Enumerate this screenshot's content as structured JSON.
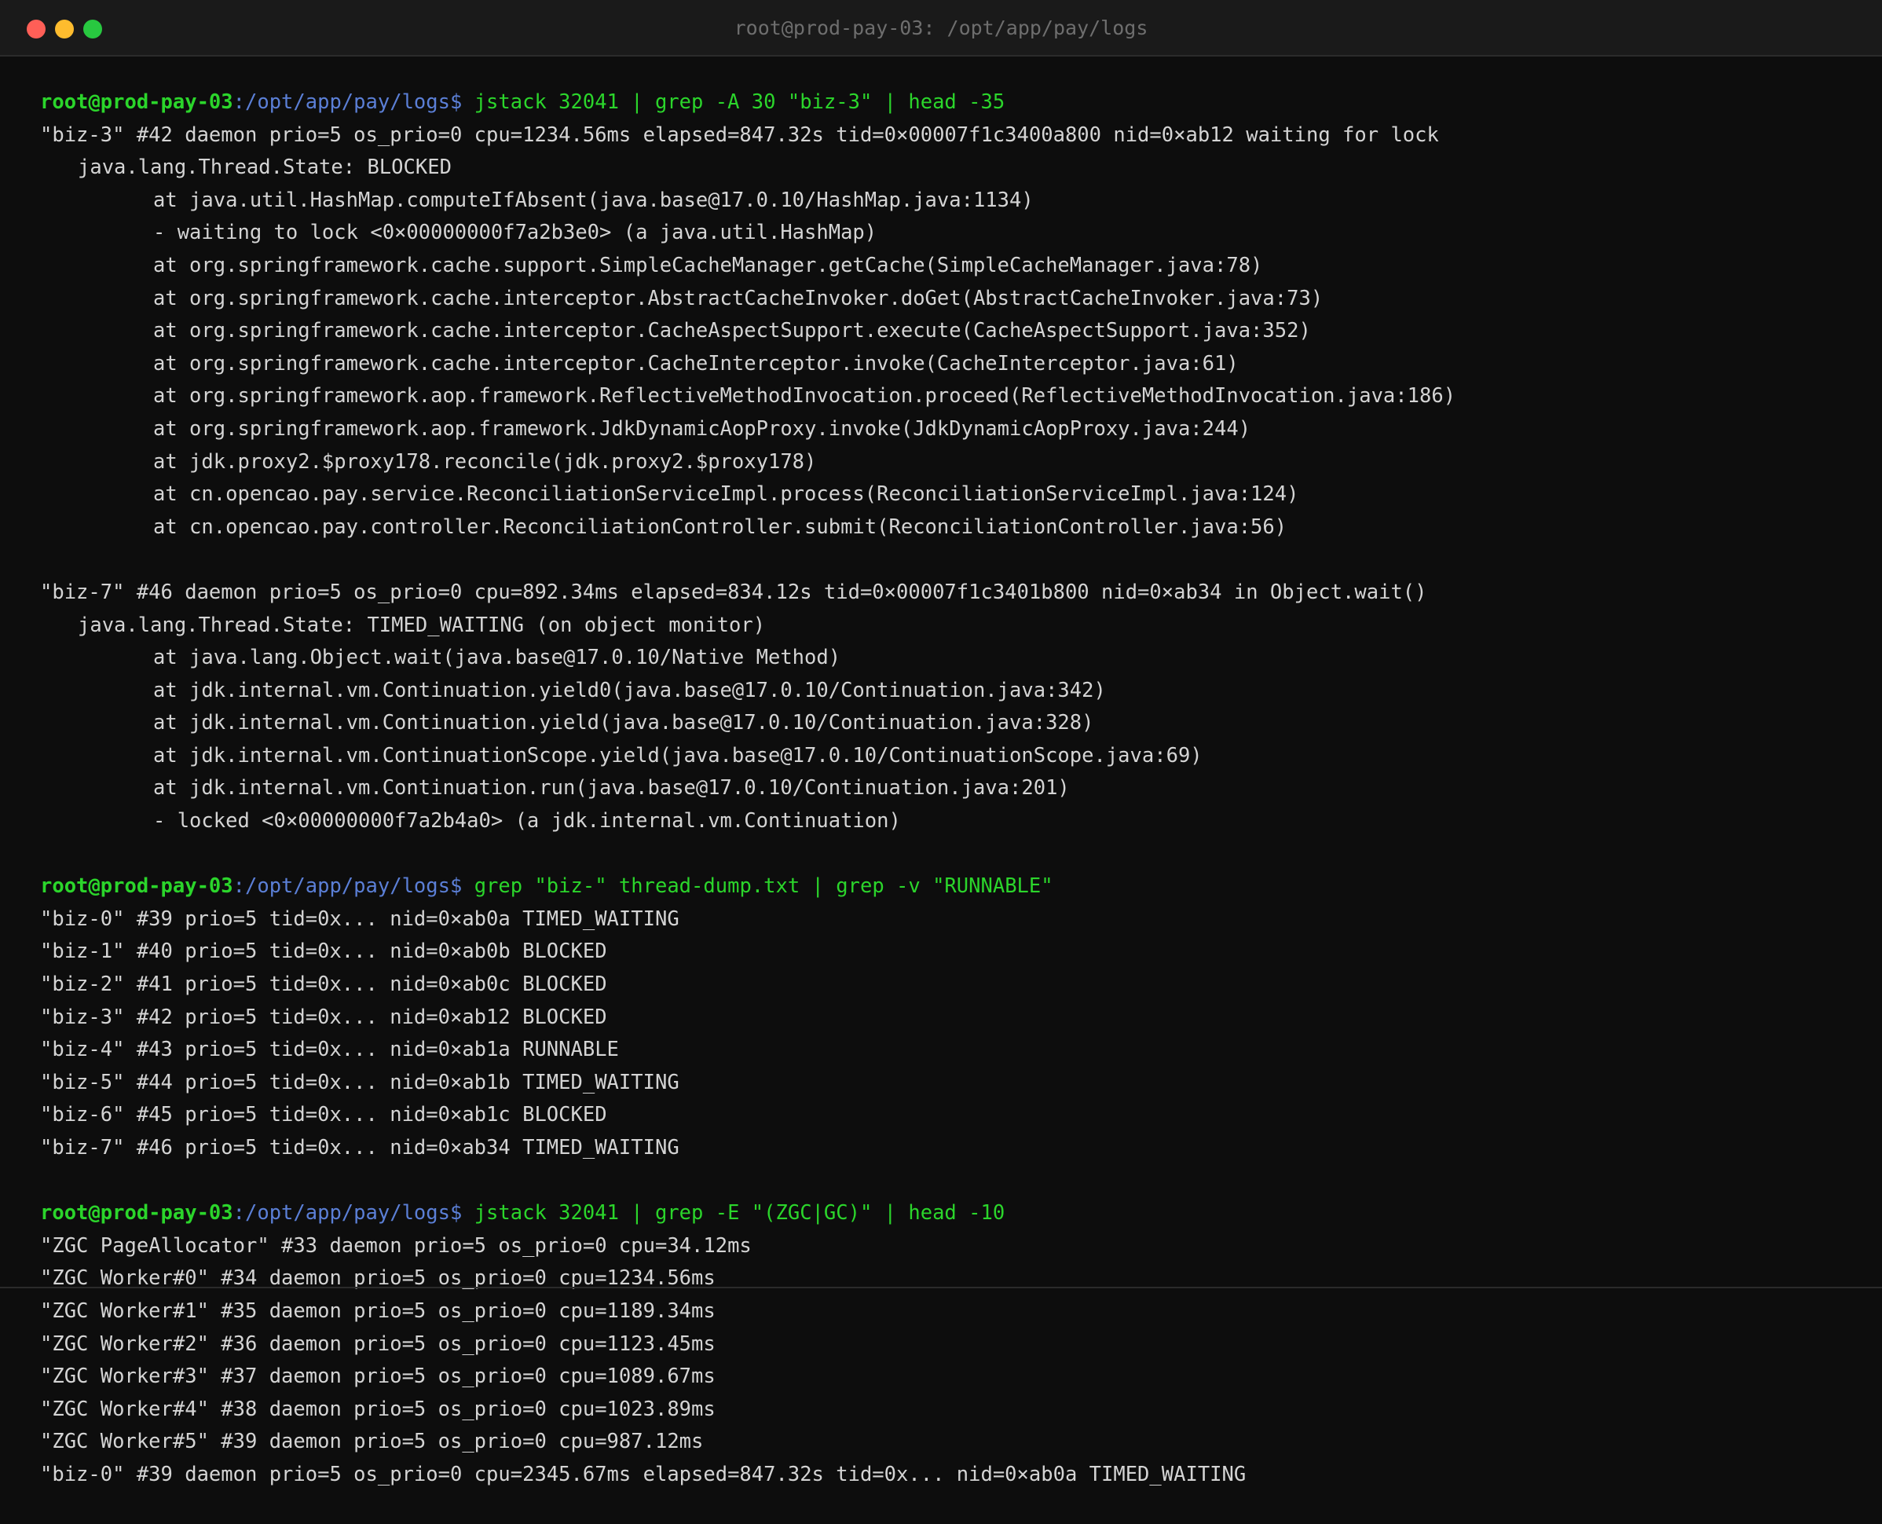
{
  "window": {
    "title": "root@prod-pay-03: /opt/app/pay/logs"
  },
  "prompt": {
    "user_host": "root@prod-pay-03",
    "path": ":/opt/app/pay/logs",
    "symbol": "$"
  },
  "blocks": [
    {
      "command": " jstack 32041 | grep -A 30 \"biz-3\" | head -35",
      "output": [
        {
          "indent": 0,
          "text": "\"biz-3\" #42 daemon prio=5 os_prio=0 cpu=1234.56ms elapsed=847.32s tid=0×00007f1c3400a800 nid=0×ab12 waiting for lock"
        },
        {
          "indent": 1,
          "text": "java.lang.Thread.State: BLOCKED"
        },
        {
          "indent": 2,
          "text": "at java.util.HashMap.computeIfAbsent(java.base@17.0.10/HashMap.java:1134)"
        },
        {
          "indent": 2,
          "text": "- waiting to lock <0×00000000f7a2b3e0> (a java.util.HashMap)"
        },
        {
          "indent": 2,
          "text": "at org.springframework.cache.support.SimpleCacheManager.getCache(SimpleCacheManager.java:78)"
        },
        {
          "indent": 2,
          "text": "at org.springframework.cache.interceptor.AbstractCacheInvoker.doGet(AbstractCacheInvoker.java:73)"
        },
        {
          "indent": 2,
          "text": "at org.springframework.cache.interceptor.CacheAspectSupport.execute(CacheAspectSupport.java:352)"
        },
        {
          "indent": 2,
          "text": "at org.springframework.cache.interceptor.CacheInterceptor.invoke(CacheInterceptor.java:61)"
        },
        {
          "indent": 2,
          "text": "at org.springframework.aop.framework.ReflectiveMethodInvocation.proceed(ReflectiveMethodInvocation.java:186)"
        },
        {
          "indent": 2,
          "text": "at org.springframework.aop.framework.JdkDynamicAopProxy.invoke(JdkDynamicAopProxy.java:244)"
        },
        {
          "indent": 2,
          "text": "at jdk.proxy2.$proxy178.reconcile(jdk.proxy2.$proxy178)"
        },
        {
          "indent": 2,
          "text": "at cn.opencao.pay.service.ReconciliationServiceImpl.process(ReconciliationServiceImpl.java:124)"
        },
        {
          "indent": 2,
          "text": "at cn.opencao.pay.controller.ReconciliationController.submit(ReconciliationController.java:56)"
        },
        {
          "indent": 0,
          "text": ""
        },
        {
          "indent": 0,
          "text": "\"biz-7\" #46 daemon prio=5 os_prio=0 cpu=892.34ms elapsed=834.12s tid=0×00007f1c3401b800 nid=0×ab34 in Object.wait()"
        },
        {
          "indent": 1,
          "text": "java.lang.Thread.State: TIMED_WAITING (on object monitor)"
        },
        {
          "indent": 2,
          "text": "at java.lang.Object.wait(java.base@17.0.10/Native Method)"
        },
        {
          "indent": 2,
          "text": "at jdk.internal.vm.Continuation.yield0(java.base@17.0.10/Continuation.java:342)"
        },
        {
          "indent": 2,
          "text": "at jdk.internal.vm.Continuation.yield(java.base@17.0.10/Continuation.java:328)"
        },
        {
          "indent": 2,
          "text": "at jdk.internal.vm.ContinuationScope.yield(java.base@17.0.10/ContinuationScope.java:69)"
        },
        {
          "indent": 2,
          "text": "at jdk.internal.vm.Continuation.run(java.base@17.0.10/Continuation.java:201)"
        },
        {
          "indent": 2,
          "text": "- locked <0×00000000f7a2b4a0> (a jdk.internal.vm.Continuation)"
        },
        {
          "indent": 0,
          "text": ""
        }
      ]
    },
    {
      "command": " grep \"biz-\" thread-dump.txt | grep -v \"RUNNABLE\"",
      "output": [
        {
          "indent": 0,
          "text": "\"biz-0\" #39 prio=5 tid=0x... nid=0×ab0a TIMED_WAITING"
        },
        {
          "indent": 0,
          "text": "\"biz-1\" #40 prio=5 tid=0x... nid=0×ab0b BLOCKED"
        },
        {
          "indent": 0,
          "text": "\"biz-2\" #41 prio=5 tid=0x... nid=0×ab0c BLOCKED"
        },
        {
          "indent": 0,
          "text": "\"biz-3\" #42 prio=5 tid=0x... nid=0×ab12 BLOCKED"
        },
        {
          "indent": 0,
          "text": "\"biz-4\" #43 prio=5 tid=0x... nid=0×ab1a RUNNABLE"
        },
        {
          "indent": 0,
          "text": "\"biz-5\" #44 prio=5 tid=0x... nid=0×ab1b TIMED_WAITING"
        },
        {
          "indent": 0,
          "text": "\"biz-6\" #45 prio=5 tid=0x... nid=0×ab1c BLOCKED"
        },
        {
          "indent": 0,
          "text": "\"biz-7\" #46 prio=5 tid=0x... nid=0×ab34 TIMED_WAITING"
        },
        {
          "indent": 0,
          "text": ""
        }
      ]
    },
    {
      "command": " jstack 32041 | grep -E \"(ZGC|GC)\" | head -10",
      "output": [
        {
          "indent": 0,
          "text": "\"ZGC PageAllocator\" #33 daemon prio=5 os_prio=0 cpu=34.12ms"
        },
        {
          "indent": 0,
          "text": "\"ZGC Worker#0\" #34 daemon prio=5 os_prio=0 cpu=1234.56ms"
        },
        {
          "indent": 0,
          "text": "\"ZGC Worker#1\" #35 daemon prio=5 os_prio=0 cpu=1189.34ms"
        },
        {
          "indent": 0,
          "text": "\"ZGC Worker#2\" #36 daemon prio=5 os_prio=0 cpu=1123.45ms"
        },
        {
          "indent": 0,
          "text": "\"ZGC Worker#3\" #37 daemon prio=5 os_prio=0 cpu=1089.67ms"
        },
        {
          "indent": 0,
          "text": "\"ZGC Worker#4\" #38 daemon prio=5 os_prio=0 cpu=1023.89ms"
        },
        {
          "indent": 0,
          "text": "\"ZGC Worker#5\" #39 daemon prio=5 os_prio=0 cpu=987.12ms"
        },
        {
          "indent": 0,
          "text": "\"biz-0\" #39 daemon prio=5 os_prio=0 cpu=2345.67ms elapsed=847.32s tid=0x... nid=0×ab0a TIMED_WAITING"
        }
      ]
    }
  ],
  "colors": {
    "background": "#0d0d0d",
    "titlebar": "#1a1a1a",
    "prompt_user": "#2bd52b",
    "prompt_path": "#5b7fd6",
    "command": "#2bd52b",
    "output_text": "#d4d4d4"
  }
}
